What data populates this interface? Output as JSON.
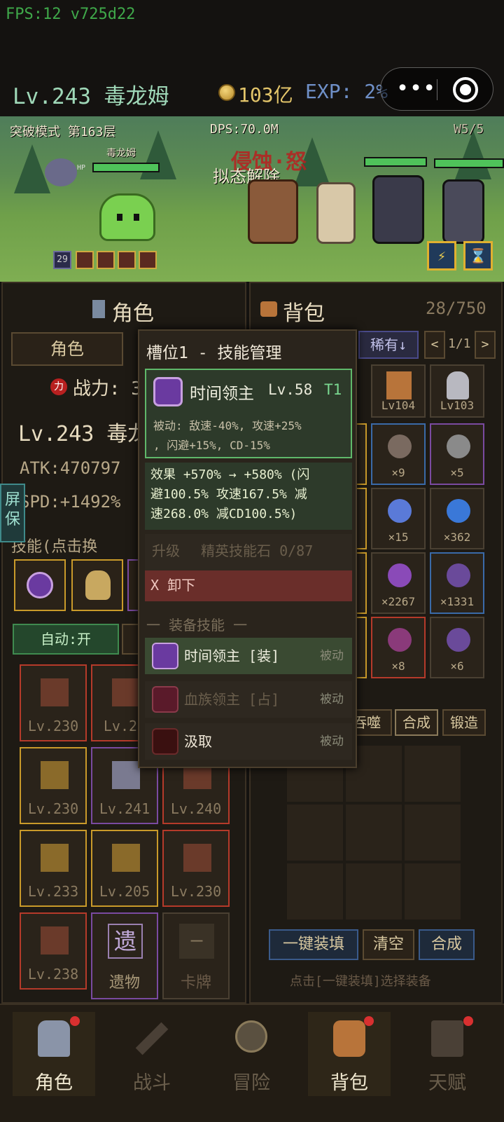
{
  "fps": "FPS:12 v725d22",
  "header": {
    "level_name": "Lv.243 毒龙姆",
    "gold": "103亿",
    "exp": "EXP: 2%"
  },
  "scene": {
    "mode": "突破模式 第163层",
    "dps": "DPS:70.0M",
    "wave": "W5/5",
    "hero_name": "毒龙姆",
    "hp_label": "HP",
    "floating_text": "拟态解除",
    "buff_count": "29",
    "status_label": "侵蚀·怒"
  },
  "left_panel": {
    "title": "角色",
    "tab": "角色",
    "power_badge": "力",
    "power_label": "战力: 3",
    "level_name": "Lv.243 毒龙",
    "atk": "ATK:470797 ",
    "spd": "SPD:+1492%",
    "skills_label": "技能(点击换",
    "auto_btn": "自动:开",
    "side_tag": "屏保",
    "equip": [
      {
        "lv": "Lv.230",
        "rarity": "red"
      },
      {
        "lv": "Lv.23",
        "rarity": "red"
      },
      {
        "lv": "",
        "rarity": "red"
      },
      {
        "lv": "Lv.230",
        "rarity": "gold"
      },
      {
        "lv": "Lv.241",
        "rarity": "pur"
      },
      {
        "lv": "Lv.240",
        "rarity": "red"
      },
      {
        "lv": "Lv.233",
        "rarity": "gold"
      },
      {
        "lv": "Lv.205",
        "rarity": "gold"
      },
      {
        "lv": "Lv.230",
        "rarity": "red"
      },
      {
        "lv": "Lv.238",
        "rarity": "red"
      }
    ],
    "relic_char": "遗",
    "relic_label": "遗物",
    "card_char": "–",
    "card_label": "卡牌"
  },
  "right_panel": {
    "title": "背包",
    "capacity": "28/750",
    "sort": "稀有↓",
    "page": "1/1",
    "prev": "<",
    "next": ">",
    "top_items": [
      {
        "lv": "Lv104"
      },
      {
        "lv": "Lv103"
      }
    ],
    "grid": [
      {
        "count": "×9",
        "rarity": "blue"
      },
      {
        "count": "×5",
        "rarity": "pur"
      },
      {
        "count": "×15",
        "rarity": "gray"
      },
      {
        "count": "×362",
        "rarity": "gray"
      },
      {
        "count": "×2267",
        "rarity": "gray"
      },
      {
        "count": "×1331",
        "rarity": "blue"
      },
      {
        "count": "×8",
        "rarity": "red"
      },
      {
        "count": "×6",
        "rarity": "gray"
      }
    ],
    "tabs": [
      "吞噬",
      "合成",
      "锻造"
    ],
    "btn_fill": "一键装填",
    "btn_clear": "清空",
    "btn_merge": "合成",
    "hint": "点击[一键装填]选择装备"
  },
  "popup": {
    "title": "槽位1 - 技能管理",
    "skill_name": "时间领主",
    "skill_level": "Lv.58",
    "skill_tier": "T1",
    "desc_line1": "被动: 敌速-40%, 攻速+25%",
    "desc_line2": ", 闪避+15%, CD-15%",
    "effect_line1": "效果 +570% → +580% (闪",
    "effect_line2": "避100.5% 攻速167.5% 减",
    "effect_line3": "速268.0% 减CD100.5%)",
    "upgrade_label": "升级",
    "upgrade_item": "精英技能石 0/87",
    "unequip": "X 卸下",
    "section": "一 装备技能 一",
    "skills": [
      {
        "name": "时间领主 [装]",
        "type": "被动"
      },
      {
        "name": "血族领主 [占]",
        "type": "被动"
      },
      {
        "name": "汲取",
        "type": "被动"
      }
    ]
  },
  "nav": [
    {
      "label": "角色",
      "active": true,
      "dot": true
    },
    {
      "label": "战斗",
      "active": false,
      "dot": false
    },
    {
      "label": "冒险",
      "active": false,
      "dot": false
    },
    {
      "label": "背包",
      "active": false,
      "dot": true
    },
    {
      "label": "天赋",
      "active": false,
      "dot": true
    }
  ],
  "colors": {
    "accent_green": "#5fb86a",
    "gold": "#e3c56a",
    "danger": "#d83030"
  }
}
